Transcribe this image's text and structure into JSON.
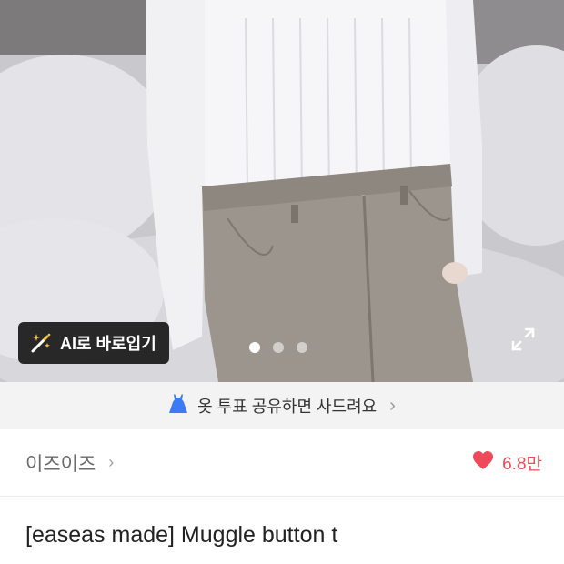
{
  "hero": {
    "ai_button_label": "AI로 바로입기",
    "carousel_dots": [
      true,
      false,
      false
    ]
  },
  "promo": {
    "text": "옷 투표 공유하면 사드려요",
    "chevron": "›"
  },
  "store": {
    "name": "이즈이즈",
    "chevron": "›",
    "likes": "6.8만"
  },
  "product": {
    "title": "[easeas made] Muggle button t"
  },
  "colors": {
    "accent_like": "#ef4a59",
    "promo_bg": "#f3f3f4",
    "dress_icon": "#3b7bf6"
  },
  "icons": [
    "wand-icon",
    "expand-icon",
    "dress-icon",
    "heart-icon",
    "chevron-right-icon"
  ]
}
